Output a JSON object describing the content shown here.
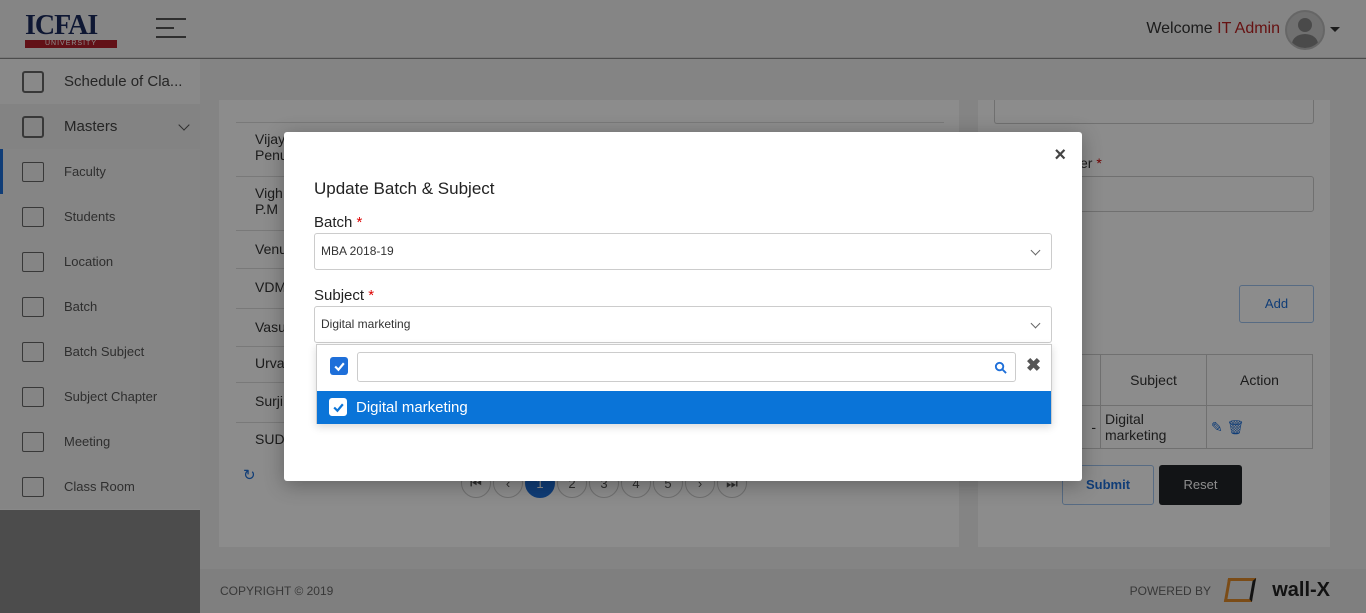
{
  "header": {
    "logo_text": "ICFAI",
    "logo_sub": "UNIVERSITY",
    "welcome": "Welcome",
    "user": "IT Admin"
  },
  "sidebar": {
    "items": [
      {
        "label": "Schedule of Cla...",
        "icon": "calendar-icon"
      },
      {
        "label": "Masters",
        "icon": "document-icon"
      },
      {
        "label": "Faculty",
        "icon": "faculty-icon"
      },
      {
        "label": "Students",
        "icon": "students-icon"
      },
      {
        "label": "Location",
        "icon": "location-icon"
      },
      {
        "label": "Batch",
        "icon": "batch-icon"
      },
      {
        "label": "Batch Subject",
        "icon": "batch-subject-icon"
      },
      {
        "label": "Subject Chapter",
        "icon": "book-icon"
      },
      {
        "label": "Meeting",
        "icon": "meeting-icon"
      },
      {
        "label": "Class Room",
        "icon": "classroom-icon"
      }
    ]
  },
  "left_list": {
    "rows": [
      "Vijay",
      "Penu",
      "Vigh",
      "P.M",
      "Venu",
      "VDM",
      "Vasu",
      "Urva",
      "Surji",
      "SUD"
    ]
  },
  "pagination": {
    "pages": [
      "1",
      "2",
      "3",
      "4",
      "5"
    ],
    "first": "⏮",
    "prev": "‹",
    "next": "›",
    "last": "⏭"
  },
  "right_panel": {
    "label_fragment": "er",
    "add_label": "Add",
    "table": {
      "headers": [
        "",
        "Subject",
        "Action"
      ],
      "row": [
        "-",
        "Digital marketing"
      ]
    },
    "submit_label": "Submit",
    "reset_label": "Reset"
  },
  "footer": {
    "copyright": "COPYRIGHT © 2019",
    "powered_by": "POWERED BY",
    "brand": "wall-X"
  },
  "modal": {
    "title": "Update Batch & Subject",
    "close": "×",
    "batch_label": "Batch",
    "batch_value": "MBA 2018-19",
    "subject_label": "Subject",
    "subject_value": "Digital marketing",
    "required_mark": "*",
    "search_value": "",
    "clear": "✖",
    "options": [
      {
        "label": "Digital marketing",
        "selected": true
      }
    ]
  },
  "colors": {
    "accent": "#0a74d8",
    "required": "#d00000",
    "brand_red": "#b3202a"
  }
}
